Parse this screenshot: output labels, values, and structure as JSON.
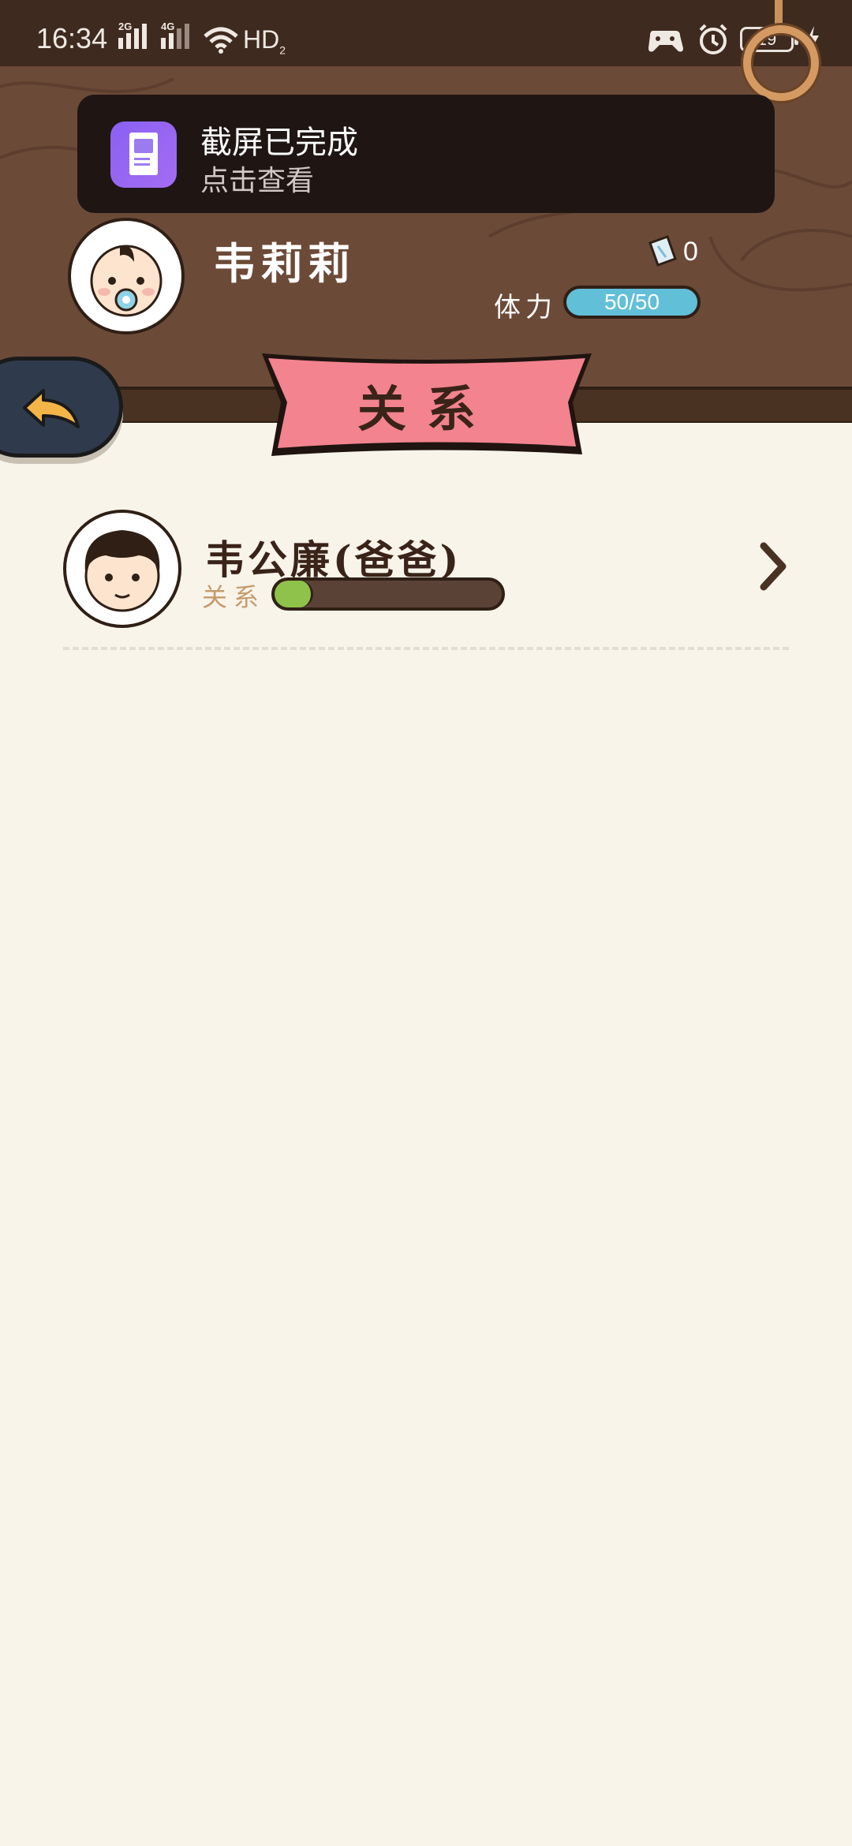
{
  "status_bar": {
    "time": "16:34",
    "signal_1": "2G",
    "signal_2": "4G",
    "network": "HD",
    "network_sub": "2",
    "battery": "19"
  },
  "notification": {
    "title": "截屏已完成",
    "subtitle": "点击查看"
  },
  "player": {
    "name": "韦莉莉",
    "tickets": "0",
    "stamina_label": "体力",
    "stamina": "50/50"
  },
  "page": {
    "title": "关系"
  },
  "relations": [
    {
      "name": "韦公廉(爸爸)",
      "label": "关系",
      "progress": 0.17
    }
  ],
  "colors": {
    "wood": "#6c4a38",
    "ribbon": "#f2838f",
    "stamina": "#62bfd8",
    "progress": "#8fc24a",
    "background": "#f8f4ea"
  }
}
